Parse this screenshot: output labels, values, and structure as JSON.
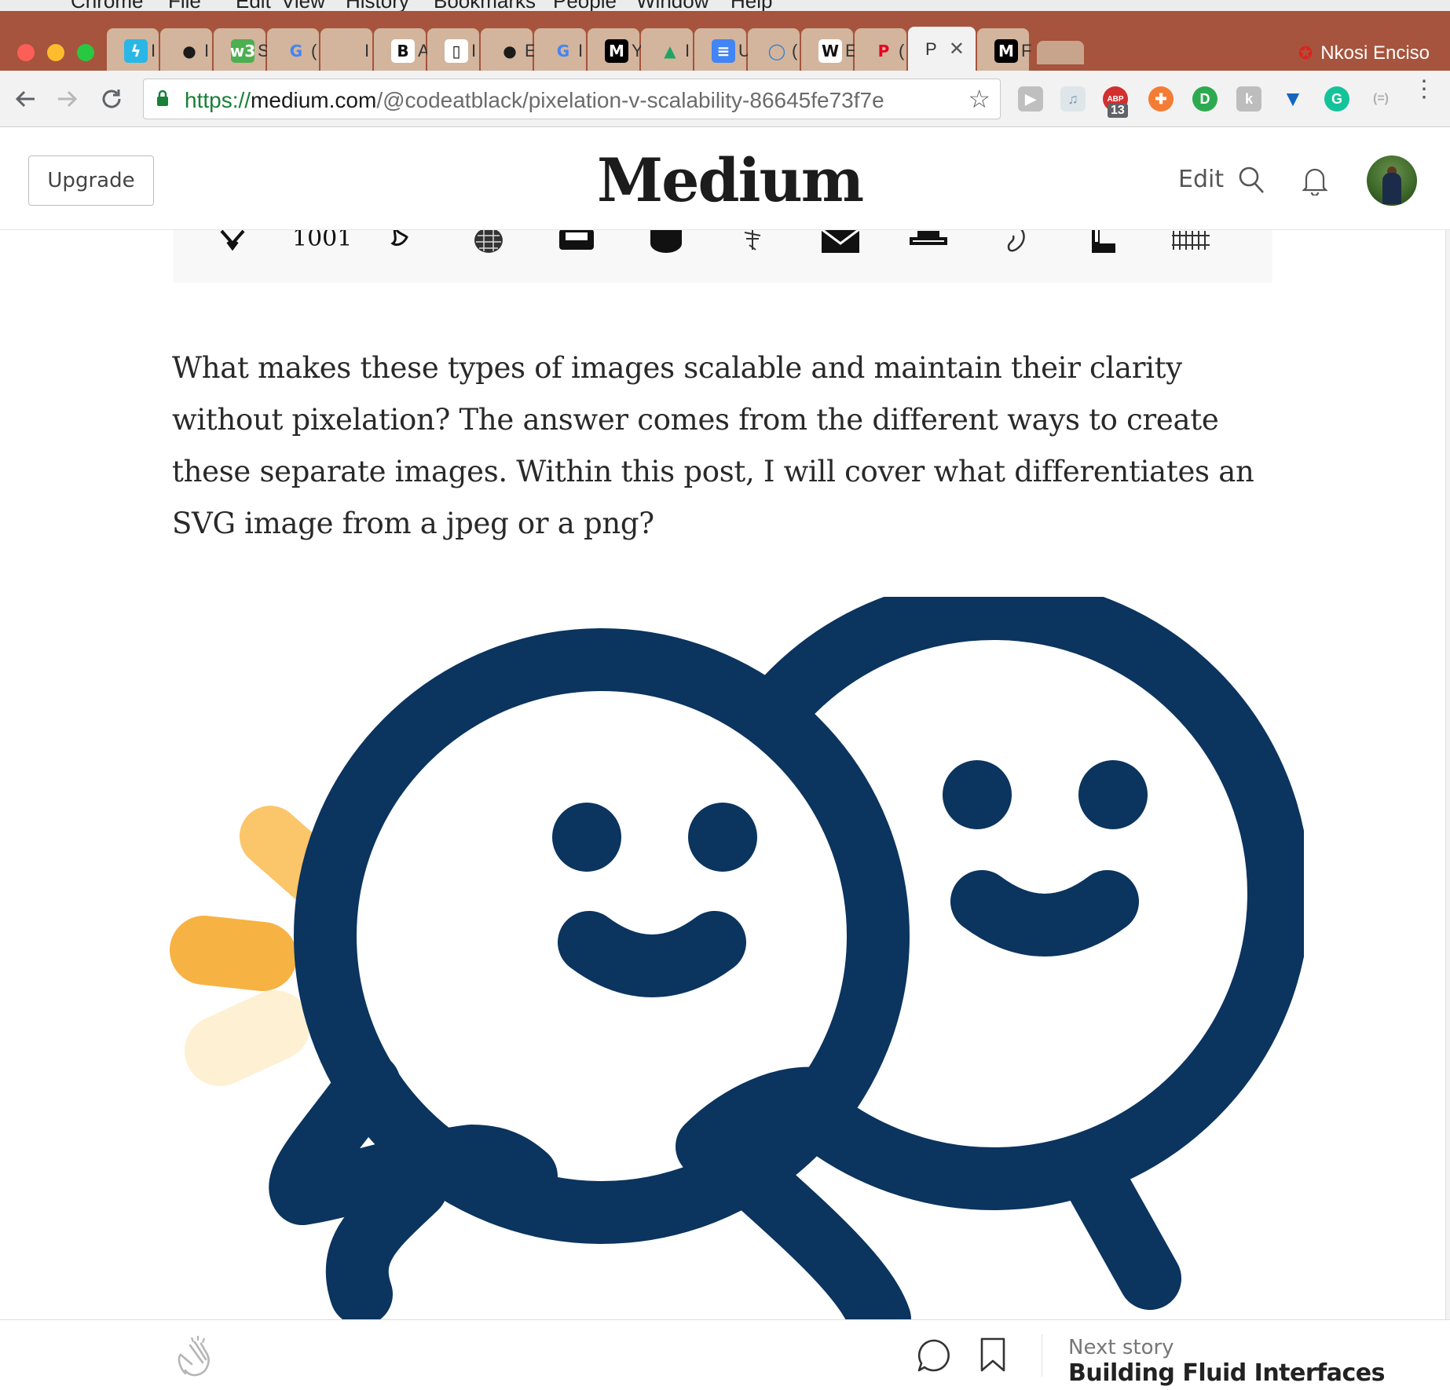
{
  "window": {
    "menu": [
      "Chrome",
      "File",
      "Edit",
      "View",
      "History",
      "Bookmarks",
      "People",
      "Window",
      "Help"
    ],
    "tabs": [
      {
        "icon": "lightning-icon",
        "title": "I",
        "color": "#2ab7e6"
      },
      {
        "icon": "github-icon",
        "title": "I",
        "color": "#1b1b1b"
      },
      {
        "icon": "w3-icon",
        "title": "S",
        "color": "#4caf50"
      },
      {
        "icon": "google-icon",
        "title": "(",
        "color": "#4285f4"
      },
      {
        "icon": "apple-icon",
        "title": "I",
        "color": "#8a8a8a"
      },
      {
        "icon": "b-icon",
        "title": "A",
        "color": "#ffffff"
      },
      {
        "icon": "doc-icon",
        "title": "I",
        "color": "#e8e8e8"
      },
      {
        "icon": "github-icon",
        "title": "E",
        "color": "#1b1b1b"
      },
      {
        "icon": "google-icon",
        "title": "I",
        "color": "#4285f4"
      },
      {
        "icon": "medium-icon",
        "title": "Y",
        "color": "#000000"
      },
      {
        "icon": "drive-icon",
        "title": "I",
        "color": "#1fa463"
      },
      {
        "icon": "docs-icon",
        "title": "U",
        "color": "#4285f4"
      },
      {
        "icon": "circle-icon",
        "title": "(",
        "color": "#2a7fd4"
      },
      {
        "icon": "wikipedia-icon",
        "title": "E",
        "color": "#ffffff"
      },
      {
        "icon": "pinterest-icon",
        "title": "(",
        "color": "#e60023"
      },
      {
        "icon": "",
        "title": "P",
        "color": "",
        "active": true
      },
      {
        "icon": "medium-icon",
        "title": "F",
        "color": "#000000"
      }
    ],
    "profile_name": "Nkosi Enciso",
    "url": {
      "scheme": "https://",
      "host": "medium.com",
      "path": "/@codeatblack/pixelation-v-scalability-86645fe73f7e"
    },
    "extensions_badge": "13"
  },
  "header": {
    "upgrade_label": "Upgrade",
    "logo": "Medium",
    "edit_label": "Edit"
  },
  "article": {
    "paragraph": "What makes these types of images scalable and maintain their clarity without pixelation? The answer comes from the different ways to create these separate images. Within this post, I will cover what differentiates an SVG image from a jpeg or a png?",
    "strip_icons": [
      "horns-icon",
      "binary-icon",
      "hand-icon",
      "pinecone-icon",
      "sofa-icon",
      "cup-icon",
      "bug-icon",
      "envelope-icon",
      "hat-icon",
      "ear-icon",
      "chair-icon",
      "fence-icon"
    ],
    "illustration_text": "1001",
    "colors": {
      "navy": "#0b345f",
      "gold": "#f7b244",
      "gold_light": "#fbc56a",
      "gold_pale": "#fef0d2"
    }
  },
  "footer": {
    "next_label": "Next story",
    "next_title": "Building Fluid Interfaces"
  }
}
